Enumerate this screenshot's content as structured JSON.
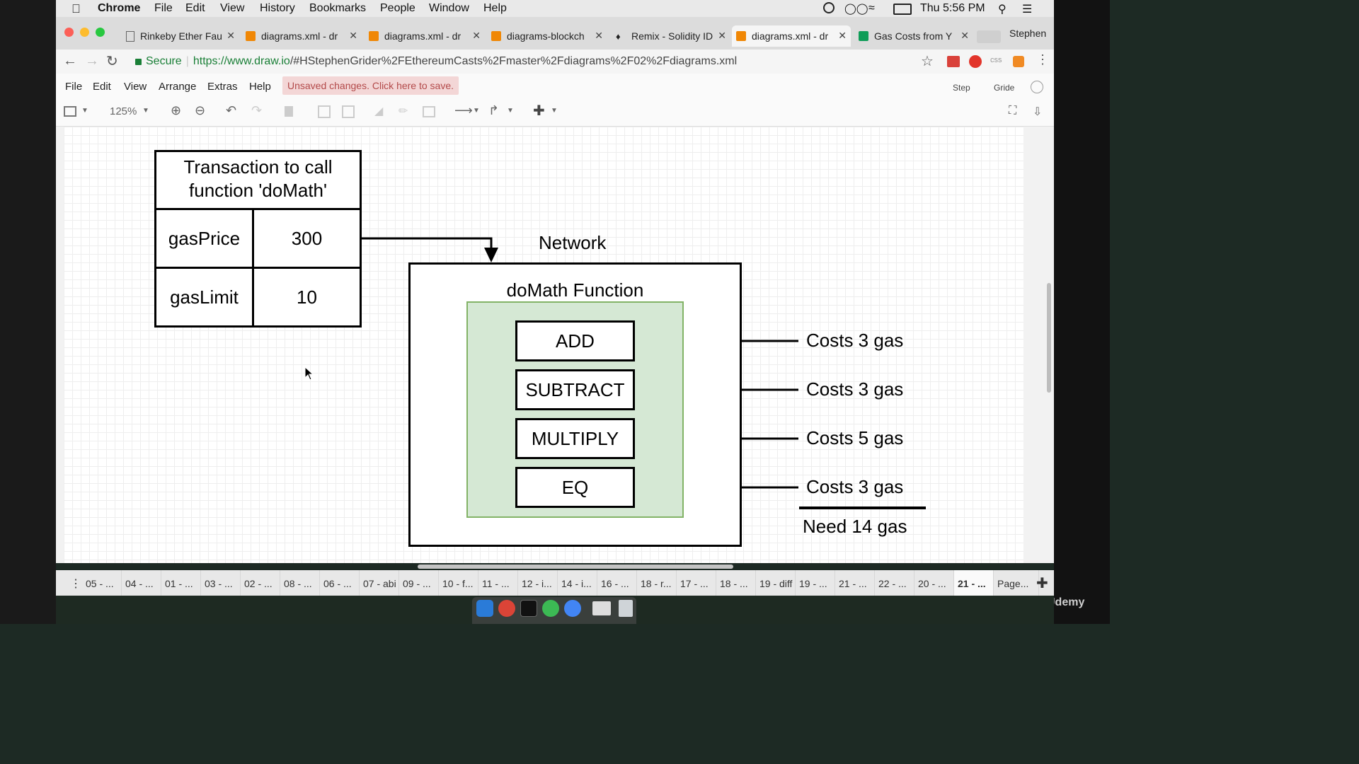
{
  "menubar": {
    "app": "Chrome",
    "items": [
      "File",
      "Edit",
      "View",
      "History",
      "Bookmarks",
      "People",
      "Window",
      "Help"
    ],
    "clock": "Thu 5:56 PM"
  },
  "tabs": [
    {
      "label": "Rinkeby Ether Fau",
      "active": false
    },
    {
      "label": "diagrams.xml - dr",
      "active": false
    },
    {
      "label": "diagrams.xml - dr",
      "active": false
    },
    {
      "label": "diagrams-blockch",
      "active": false
    },
    {
      "label": "Remix - Solidity ID",
      "active": false
    },
    {
      "label": "diagrams.xml - dr",
      "active": true
    },
    {
      "label": "Gas Costs from Y",
      "active": false
    }
  ],
  "profile": "Stephen",
  "address": {
    "secure_label": "Secure",
    "url_prefix": "https://www.draw.io",
    "url_rest": "/#HStephenGrider%2FEthereumCasts%2Fmaster%2Fdiagrams%2F02%2Fdiagrams.xml"
  },
  "app_menu": {
    "items": [
      "File",
      "Edit",
      "View",
      "Arrange",
      "Extras",
      "Help"
    ],
    "unsaved": "Unsaved changes. Click here to save.",
    "right_a": "Step",
    "right_b": "Gride"
  },
  "toolbar": {
    "zoom": "125%"
  },
  "diagram": {
    "transaction_title_line1": "Transaction to call",
    "transaction_title_line2": "function 'doMath'",
    "rows": [
      {
        "key": "gasPrice",
        "value": "300"
      },
      {
        "key": "gasLimit",
        "value": "10"
      }
    ],
    "network_label": "Network",
    "function_label": "doMath Function",
    "ops": [
      {
        "name": "ADD",
        "cost": "Costs 3 gas"
      },
      {
        "name": "SUBTRACT",
        "cost": "Costs 3 gas"
      },
      {
        "name": "MULTIPLY",
        "cost": "Costs 5 gas"
      },
      {
        "name": "EQ",
        "cost": "Costs 3 gas"
      }
    ],
    "total": "Need 14 gas"
  },
  "pages": [
    "05 - ...",
    "04 - ...",
    "01 - ...",
    "03 - ...",
    "02 - ...",
    "08 - ...",
    "06 - ...",
    "07 - abi",
    "09 - ...",
    "10 - f...",
    "11 - ...",
    "12 - i...",
    "14 - i...",
    "16 - ...",
    "18 - r...",
    "17 - ...",
    "18 - ...",
    "19 - diff",
    "19 - ...",
    "21 - ...",
    "22 - ...",
    "20 - ...",
    "21 - ...",
    "Page..."
  ],
  "watermark": "Udemy",
  "colors": {
    "function_fill": "#d5e8d4",
    "function_border": "#82b366",
    "secure_green": "#1a7f37",
    "unsaved_bg": "#f3d6d6",
    "unsaved_text": "#b34a4a"
  }
}
